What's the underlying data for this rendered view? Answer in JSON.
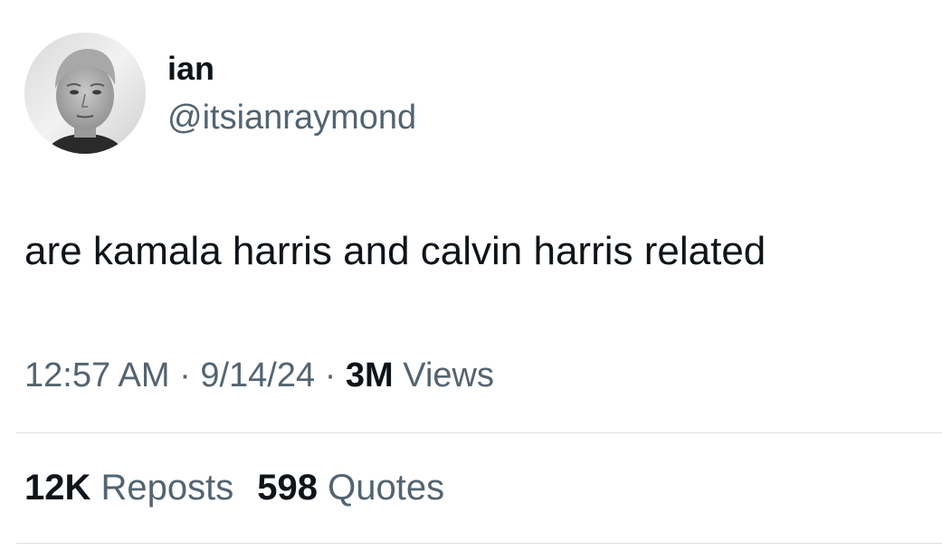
{
  "author": {
    "display_name": "ian",
    "handle": "@itsianraymond",
    "avatar_icon": "profile-photo-icon"
  },
  "tweet": {
    "text": "are kamala harris and calvin harris related"
  },
  "meta": {
    "time": "12:57 AM",
    "separator": "·",
    "date": "9/14/24",
    "views_count": "3M",
    "views_label": "Views"
  },
  "stats": {
    "reposts_count": "12K",
    "reposts_label": "Reposts",
    "quotes_count": "598",
    "quotes_label": "Quotes"
  },
  "colors": {
    "text_primary": "#0f1419",
    "text_secondary": "#536471",
    "divider": "#dcdfe2"
  }
}
